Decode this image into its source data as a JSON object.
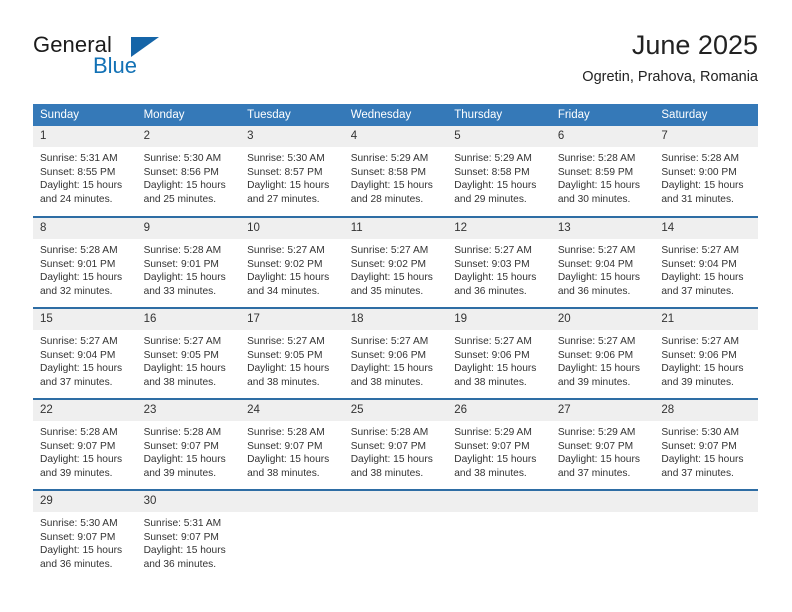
{
  "logo": {
    "word_one": "General",
    "word_two": "Blue",
    "triangle_icon": "blue-triangle-icon"
  },
  "header": {
    "title": "June 2025",
    "location": "Ogretin, Prahova, Romania"
  },
  "colors": {
    "header_blue": "#3579b8",
    "row_border_blue": "#2e6da4",
    "daynum_bg": "#efefef",
    "logo_blue": "#1271b5"
  },
  "calendar": {
    "weekday_headers": [
      "Sunday",
      "Monday",
      "Tuesday",
      "Wednesday",
      "Thursday",
      "Friday",
      "Saturday"
    ],
    "weeks": [
      [
        {
          "day": "1",
          "sunrise": "Sunrise: 5:31 AM",
          "sunset": "Sunset: 8:55 PM",
          "daylight_line1": "Daylight: 15 hours",
          "daylight_line2": "and 24 minutes."
        },
        {
          "day": "2",
          "sunrise": "Sunrise: 5:30 AM",
          "sunset": "Sunset: 8:56 PM",
          "daylight_line1": "Daylight: 15 hours",
          "daylight_line2": "and 25 minutes."
        },
        {
          "day": "3",
          "sunrise": "Sunrise: 5:30 AM",
          "sunset": "Sunset: 8:57 PM",
          "daylight_line1": "Daylight: 15 hours",
          "daylight_line2": "and 27 minutes."
        },
        {
          "day": "4",
          "sunrise": "Sunrise: 5:29 AM",
          "sunset": "Sunset: 8:58 PM",
          "daylight_line1": "Daylight: 15 hours",
          "daylight_line2": "and 28 minutes."
        },
        {
          "day": "5",
          "sunrise": "Sunrise: 5:29 AM",
          "sunset": "Sunset: 8:58 PM",
          "daylight_line1": "Daylight: 15 hours",
          "daylight_line2": "and 29 minutes."
        },
        {
          "day": "6",
          "sunrise": "Sunrise: 5:28 AM",
          "sunset": "Sunset: 8:59 PM",
          "daylight_line1": "Daylight: 15 hours",
          "daylight_line2": "and 30 minutes."
        },
        {
          "day": "7",
          "sunrise": "Sunrise: 5:28 AM",
          "sunset": "Sunset: 9:00 PM",
          "daylight_line1": "Daylight: 15 hours",
          "daylight_line2": "and 31 minutes."
        }
      ],
      [
        {
          "day": "8",
          "sunrise": "Sunrise: 5:28 AM",
          "sunset": "Sunset: 9:01 PM",
          "daylight_line1": "Daylight: 15 hours",
          "daylight_line2": "and 32 minutes."
        },
        {
          "day": "9",
          "sunrise": "Sunrise: 5:28 AM",
          "sunset": "Sunset: 9:01 PM",
          "daylight_line1": "Daylight: 15 hours",
          "daylight_line2": "and 33 minutes."
        },
        {
          "day": "10",
          "sunrise": "Sunrise: 5:27 AM",
          "sunset": "Sunset: 9:02 PM",
          "daylight_line1": "Daylight: 15 hours",
          "daylight_line2": "and 34 minutes."
        },
        {
          "day": "11",
          "sunrise": "Sunrise: 5:27 AM",
          "sunset": "Sunset: 9:02 PM",
          "daylight_line1": "Daylight: 15 hours",
          "daylight_line2": "and 35 minutes."
        },
        {
          "day": "12",
          "sunrise": "Sunrise: 5:27 AM",
          "sunset": "Sunset: 9:03 PM",
          "daylight_line1": "Daylight: 15 hours",
          "daylight_line2": "and 36 minutes."
        },
        {
          "day": "13",
          "sunrise": "Sunrise: 5:27 AM",
          "sunset": "Sunset: 9:04 PM",
          "daylight_line1": "Daylight: 15 hours",
          "daylight_line2": "and 36 minutes."
        },
        {
          "day": "14",
          "sunrise": "Sunrise: 5:27 AM",
          "sunset": "Sunset: 9:04 PM",
          "daylight_line1": "Daylight: 15 hours",
          "daylight_line2": "and 37 minutes."
        }
      ],
      [
        {
          "day": "15",
          "sunrise": "Sunrise: 5:27 AM",
          "sunset": "Sunset: 9:04 PM",
          "daylight_line1": "Daylight: 15 hours",
          "daylight_line2": "and 37 minutes."
        },
        {
          "day": "16",
          "sunrise": "Sunrise: 5:27 AM",
          "sunset": "Sunset: 9:05 PM",
          "daylight_line1": "Daylight: 15 hours",
          "daylight_line2": "and 38 minutes."
        },
        {
          "day": "17",
          "sunrise": "Sunrise: 5:27 AM",
          "sunset": "Sunset: 9:05 PM",
          "daylight_line1": "Daylight: 15 hours",
          "daylight_line2": "and 38 minutes."
        },
        {
          "day": "18",
          "sunrise": "Sunrise: 5:27 AM",
          "sunset": "Sunset: 9:06 PM",
          "daylight_line1": "Daylight: 15 hours",
          "daylight_line2": "and 38 minutes."
        },
        {
          "day": "19",
          "sunrise": "Sunrise: 5:27 AM",
          "sunset": "Sunset: 9:06 PM",
          "daylight_line1": "Daylight: 15 hours",
          "daylight_line2": "and 38 minutes."
        },
        {
          "day": "20",
          "sunrise": "Sunrise: 5:27 AM",
          "sunset": "Sunset: 9:06 PM",
          "daylight_line1": "Daylight: 15 hours",
          "daylight_line2": "and 39 minutes."
        },
        {
          "day": "21",
          "sunrise": "Sunrise: 5:27 AM",
          "sunset": "Sunset: 9:06 PM",
          "daylight_line1": "Daylight: 15 hours",
          "daylight_line2": "and 39 minutes."
        }
      ],
      [
        {
          "day": "22",
          "sunrise": "Sunrise: 5:28 AM",
          "sunset": "Sunset: 9:07 PM",
          "daylight_line1": "Daylight: 15 hours",
          "daylight_line2": "and 39 minutes."
        },
        {
          "day": "23",
          "sunrise": "Sunrise: 5:28 AM",
          "sunset": "Sunset: 9:07 PM",
          "daylight_line1": "Daylight: 15 hours",
          "daylight_line2": "and 39 minutes."
        },
        {
          "day": "24",
          "sunrise": "Sunrise: 5:28 AM",
          "sunset": "Sunset: 9:07 PM",
          "daylight_line1": "Daylight: 15 hours",
          "daylight_line2": "and 38 minutes."
        },
        {
          "day": "25",
          "sunrise": "Sunrise: 5:28 AM",
          "sunset": "Sunset: 9:07 PM",
          "daylight_line1": "Daylight: 15 hours",
          "daylight_line2": "and 38 minutes."
        },
        {
          "day": "26",
          "sunrise": "Sunrise: 5:29 AM",
          "sunset": "Sunset: 9:07 PM",
          "daylight_line1": "Daylight: 15 hours",
          "daylight_line2": "and 38 minutes."
        },
        {
          "day": "27",
          "sunrise": "Sunrise: 5:29 AM",
          "sunset": "Sunset: 9:07 PM",
          "daylight_line1": "Daylight: 15 hours",
          "daylight_line2": "and 37 minutes."
        },
        {
          "day": "28",
          "sunrise": "Sunrise: 5:30 AM",
          "sunset": "Sunset: 9:07 PM",
          "daylight_line1": "Daylight: 15 hours",
          "daylight_line2": "and 37 minutes."
        }
      ],
      [
        {
          "day": "29",
          "sunrise": "Sunrise: 5:30 AM",
          "sunset": "Sunset: 9:07 PM",
          "daylight_line1": "Daylight: 15 hours",
          "daylight_line2": "and 36 minutes."
        },
        {
          "day": "30",
          "sunrise": "Sunrise: 5:31 AM",
          "sunset": "Sunset: 9:07 PM",
          "daylight_line1": "Daylight: 15 hours",
          "daylight_line2": "and 36 minutes."
        },
        {
          "day": "",
          "sunrise": "",
          "sunset": "",
          "daylight_line1": "",
          "daylight_line2": ""
        },
        {
          "day": "",
          "sunrise": "",
          "sunset": "",
          "daylight_line1": "",
          "daylight_line2": ""
        },
        {
          "day": "",
          "sunrise": "",
          "sunset": "",
          "daylight_line1": "",
          "daylight_line2": ""
        },
        {
          "day": "",
          "sunrise": "",
          "sunset": "",
          "daylight_line1": "",
          "daylight_line2": ""
        },
        {
          "day": "",
          "sunrise": "",
          "sunset": "",
          "daylight_line1": "",
          "daylight_line2": ""
        }
      ]
    ]
  }
}
